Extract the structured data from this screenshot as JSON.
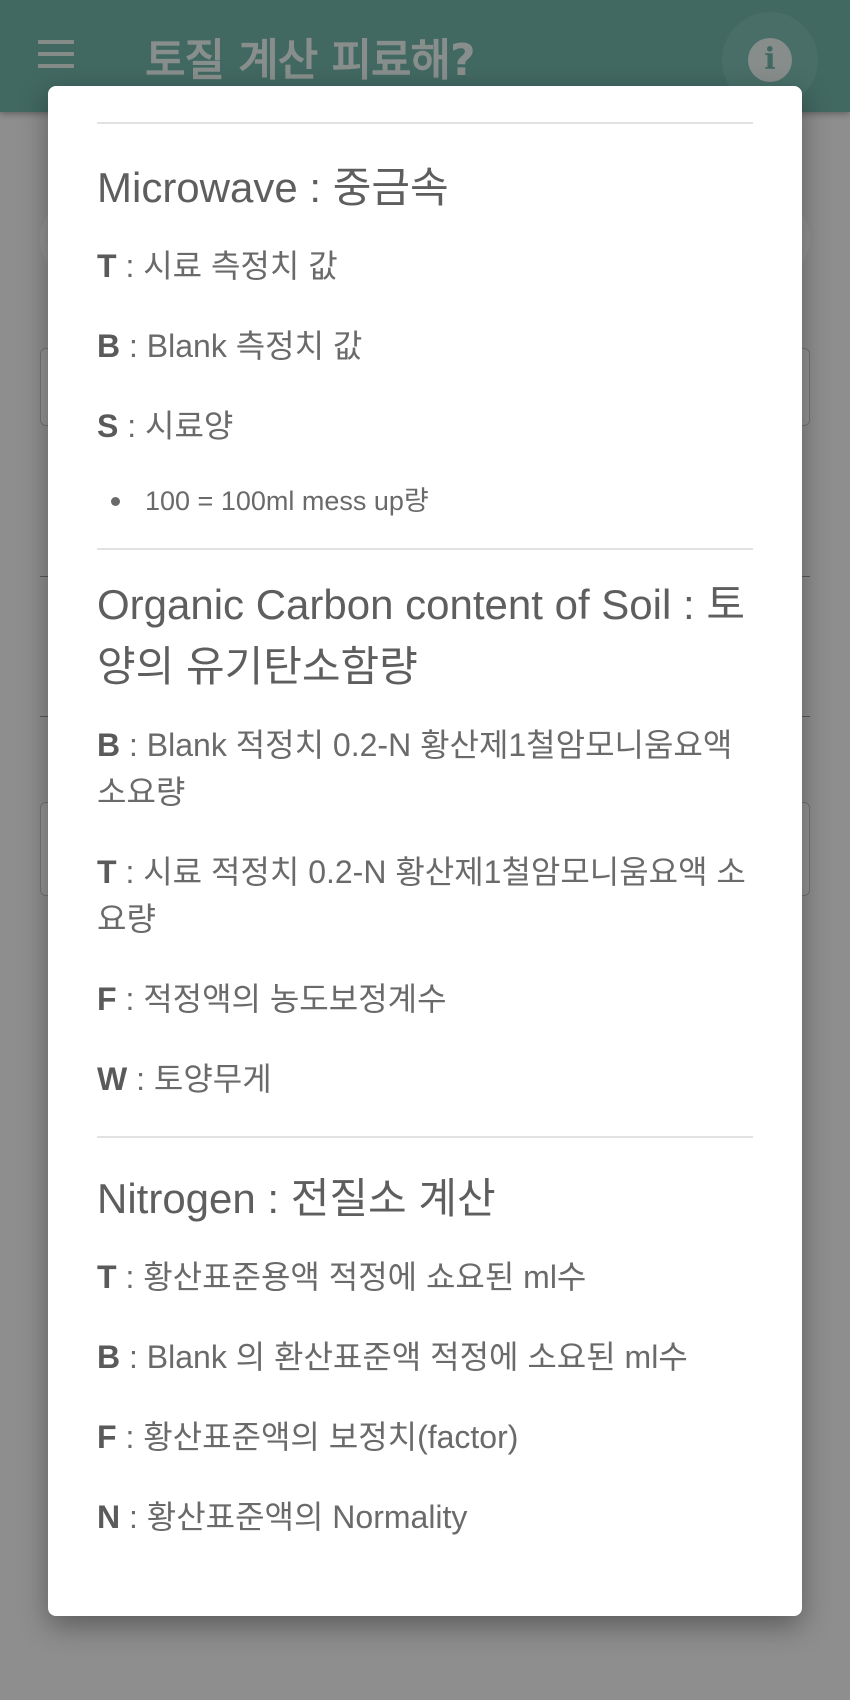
{
  "appbar": {
    "title": "토질 계산 피료해?",
    "menu_icon": "menu-icon",
    "info_icon": "info-icon",
    "info_glyph": "i",
    "color": "#70b3a8"
  },
  "dialog": {
    "microwave": {
      "title": "Microwave : 중금속",
      "items": [
        {
          "sym": "T",
          "text": " : 시료 측정치 값"
        },
        {
          "sym": "B",
          "text": " : Blank 측정치 값"
        },
        {
          "sym": "S",
          "text": " : 시료양"
        }
      ],
      "bullet": "100 = 100ml mess up량"
    },
    "organic": {
      "title": "Organic Carbon content of Soil : 토양의 유기탄소함량",
      "items": [
        {
          "sym": "B",
          "text": " : Blank 적정치 0.2-N 황산제1철암모니움요액 소요량"
        },
        {
          "sym": "T",
          "text": " : 시료 적정치 0.2-N 황산제1철암모니움요액 소요량"
        },
        {
          "sym": "F",
          "text": " : 적정액의 농도보정계수"
        },
        {
          "sym": "W",
          "text": " : 토양무게"
        }
      ]
    },
    "nitrogen": {
      "title": "Nitrogen : 전질소 계산",
      "items": [
        {
          "sym": "T",
          "text": " : 황산표준용액 적정에 쇼요된 ml수"
        },
        {
          "sym": "B",
          "text": " : Blank 의 환산표준액 적정에 소요된 ml수"
        },
        {
          "sym": "F",
          "text": " : 황산표준액의 보정치(factor)"
        },
        {
          "sym": "N",
          "text": " : 황산표준액의 Normality"
        }
      ]
    }
  }
}
